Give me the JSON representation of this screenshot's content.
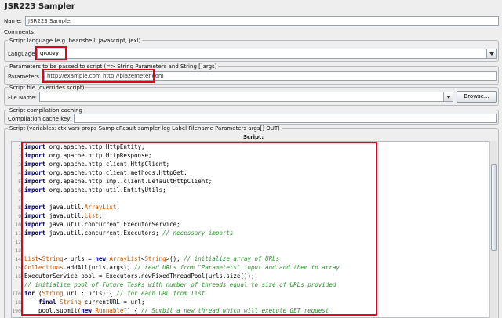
{
  "title": "JSR223 Sampler",
  "name_label": "Name:",
  "name_value": "JSR223 Sampler",
  "comments_label": "Comments:",
  "lang_panel_title": "Script language (e.g. beanshell, javascript, jexl)",
  "lang_label": "Language",
  "lang_value": "groovy",
  "params_panel_title": "Parameters to be passed to script (=> String Parameters and String []args)",
  "params_label": "Parameters",
  "params_value": "http://example.com http://blazemeter.com",
  "file_panel_title": "Script file (overrides script)",
  "file_label": "File Name:",
  "file_value": "",
  "browse_label": "Browse...",
  "cache_panel_title": "Script compilation caching",
  "cache_label": "Compilation cache key:",
  "cache_value": "",
  "script_panel_title": "Script (variables: ctx vars props SampleResult sampler log Label Filename Parameters args[] OUT)",
  "script_header": "Script:",
  "code_lines": [
    {
      "n": "1",
      "segs": [
        {
          "c": "kw",
          "t": "import"
        },
        {
          "c": "plain",
          "t": " org.apache.http.HttpEntity;"
        }
      ]
    },
    {
      "n": "2",
      "segs": [
        {
          "c": "kw",
          "t": "import"
        },
        {
          "c": "plain",
          "t": " org.apache.http.HttpResponse;"
        }
      ]
    },
    {
      "n": "3",
      "segs": [
        {
          "c": "kw",
          "t": "import"
        },
        {
          "c": "plain",
          "t": " org.apache.http.client.HttpClient;"
        }
      ]
    },
    {
      "n": "4",
      "segs": [
        {
          "c": "kw",
          "t": "import"
        },
        {
          "c": "plain",
          "t": " org.apache.http.client.methods.HttpGet;"
        }
      ]
    },
    {
      "n": "5",
      "segs": [
        {
          "c": "kw",
          "t": "import"
        },
        {
          "c": "plain",
          "t": " org.apache.http.impl.client.DefaultHttpClient;"
        }
      ]
    },
    {
      "n": "6",
      "segs": [
        {
          "c": "kw",
          "t": "import"
        },
        {
          "c": "plain",
          "t": " org.apache.http.util.EntityUtils;"
        }
      ]
    },
    {
      "n": "7",
      "segs": []
    },
    {
      "n": "8",
      "segs": [
        {
          "c": "kw",
          "t": "import"
        },
        {
          "c": "plain",
          "t": " java.util."
        },
        {
          "c": "ty",
          "t": "ArrayList"
        },
        {
          "c": "plain",
          "t": ";"
        }
      ]
    },
    {
      "n": "9",
      "segs": [
        {
          "c": "kw",
          "t": "import"
        },
        {
          "c": "plain",
          "t": " java.util."
        },
        {
          "c": "ty",
          "t": "List"
        },
        {
          "c": "plain",
          "t": ";"
        }
      ]
    },
    {
      "n": "10",
      "segs": [
        {
          "c": "kw",
          "t": "import"
        },
        {
          "c": "plain",
          "t": " java.util.concurrent.ExecutorService;"
        }
      ]
    },
    {
      "n": "11",
      "segs": [
        {
          "c": "kw",
          "t": "import"
        },
        {
          "c": "plain",
          "t": " java.util.concurrent.Executors; "
        },
        {
          "c": "cm",
          "t": "// necessary imports"
        }
      ]
    },
    {
      "n": "12",
      "segs": []
    },
    {
      "n": "13",
      "segs": []
    },
    {
      "n": "14",
      "segs": [
        {
          "c": "ty",
          "t": "List"
        },
        {
          "c": "plain",
          "t": "<"
        },
        {
          "c": "ty",
          "t": "String"
        },
        {
          "c": "plain",
          "t": "> urls = "
        },
        {
          "c": "kw",
          "t": "new"
        },
        {
          "c": "plain",
          "t": " "
        },
        {
          "c": "ty",
          "t": "ArrayList"
        },
        {
          "c": "plain",
          "t": "<"
        },
        {
          "c": "ty",
          "t": "String"
        },
        {
          "c": "plain",
          "t": ">(); "
        },
        {
          "c": "cm",
          "t": "// initialize array of URLs"
        }
      ]
    },
    {
      "n": "15",
      "segs": [
        {
          "c": "ty",
          "t": "Collections"
        },
        {
          "c": "plain",
          "t": ".addAll(urls,args); "
        },
        {
          "c": "cm",
          "t": "// read URLs from \"Parameters\" input and add them to array"
        }
      ]
    },
    {
      "n": "16",
      "segs": [
        {
          "c": "plain",
          "t": "ExecutorService pool = Executors.newFixedThreadPool(urls.size());"
        }
      ]
    },
    {
      "n": "",
      "segs": [
        {
          "c": "cm",
          "t": "// initialize pool of Future Tasks with number of threads equal to size of URLs provided"
        }
      ]
    },
    {
      "n": "17⊖",
      "segs": [
        {
          "c": "kw",
          "t": "for"
        },
        {
          "c": "plain",
          "t": " ("
        },
        {
          "c": "ty",
          "t": "String"
        },
        {
          "c": "plain",
          "t": " url : urls) { "
        },
        {
          "c": "cm",
          "t": "// for each URL from list"
        }
      ]
    },
    {
      "n": "18",
      "segs": [
        {
          "c": "plain",
          "t": "    "
        },
        {
          "c": "kw",
          "t": "final"
        },
        {
          "c": "plain",
          "t": " "
        },
        {
          "c": "ty",
          "t": "String"
        },
        {
          "c": "plain",
          "t": " currentURL = url;"
        }
      ]
    },
    {
      "n": "19⊖",
      "segs": [
        {
          "c": "plain",
          "t": "    pool.submit("
        },
        {
          "c": "kw",
          "t": "new"
        },
        {
          "c": "plain",
          "t": " "
        },
        {
          "c": "ty",
          "t": "Runnable"
        },
        {
          "c": "plain",
          "t": "() { "
        },
        {
          "c": "cm",
          "t": "// Sumbit a new thread which will execute GET request"
        }
      ]
    }
  ]
}
